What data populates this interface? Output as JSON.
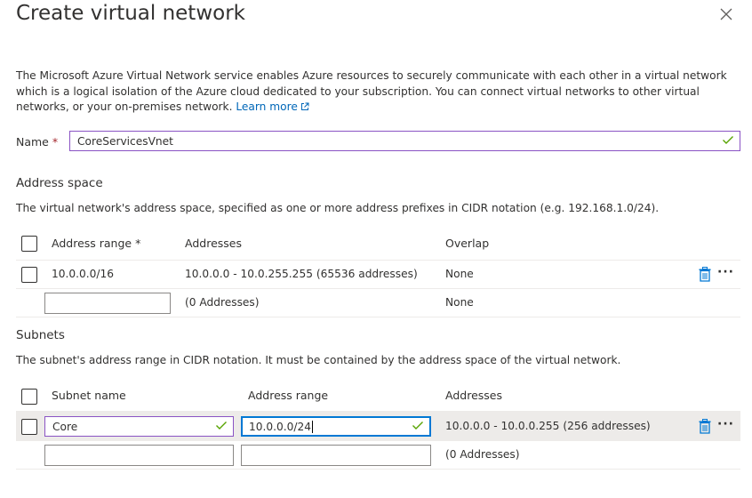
{
  "panel": {
    "title": "Create virtual network",
    "description": "The Microsoft Azure Virtual Network service enables Azure resources to securely communicate with each other in a virtual network which is a logical isolation of the Azure cloud dedicated to your subscription. You can connect virtual networks to other virtual networks, or your on-premises network.",
    "learn_more": "Learn more",
    "close_icon": "close-icon"
  },
  "name_field": {
    "label": "Name",
    "required": "*",
    "value": "CoreServicesVnet"
  },
  "address_space": {
    "title": "Address space",
    "description": "The virtual network's address space, specified as one or more address prefixes in CIDR notation (e.g. 192.168.1.0/24).",
    "columns": {
      "range": "Address range",
      "required": "*",
      "addresses": "Addresses",
      "overlap": "Overlap"
    },
    "rows": [
      {
        "range": "10.0.0.0/16",
        "addresses": "10.0.0.0 - 10.0.255.255 (65536 addresses)",
        "overlap": "None"
      }
    ],
    "new_row": {
      "range": "",
      "addresses": "(0 Addresses)",
      "overlap": "None"
    }
  },
  "subnets": {
    "title": "Subnets",
    "description": "The subnet's address range in CIDR notation. It must be contained by the address space of the virtual network.",
    "columns": {
      "name": "Subnet name",
      "range": "Address range",
      "addresses": "Addresses"
    },
    "rows": [
      {
        "name": "Core",
        "range": "10.0.0.0/24",
        "addresses": "10.0.0.0 - 10.0.0.255 (256 addresses)"
      }
    ],
    "new_row": {
      "name": "",
      "range": "",
      "addresses": "(0 Addresses)"
    }
  },
  "colors": {
    "accent": "#0078d4",
    "link": "#0067b8",
    "valid": "#57a300",
    "required": "#a4262c",
    "valid_border": "#8a53c4",
    "trash": "#0078d4"
  }
}
